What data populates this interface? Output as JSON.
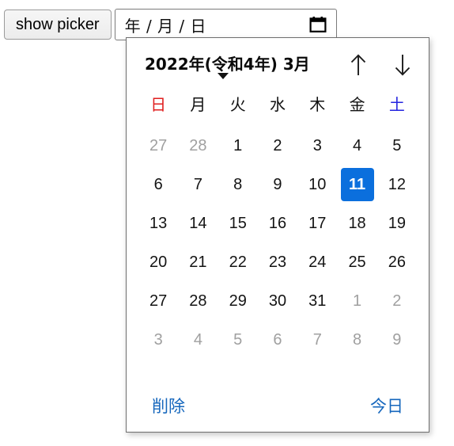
{
  "toolbar": {
    "show_picker_label": "show picker"
  },
  "date_input": {
    "placeholder_text": "年 / 月 / 日",
    "value": "",
    "calendar_icon": "calendar-icon"
  },
  "picker": {
    "header": {
      "month_title": "2022年(令和4年) 3月",
      "caret_icon": "chevron-down-icon",
      "prev_icon": "arrow-up-icon",
      "next_icon": "arrow-down-icon"
    },
    "weekdays": [
      {
        "label": "日",
        "kind": "sun"
      },
      {
        "label": "月",
        "kind": "weekday"
      },
      {
        "label": "火",
        "kind": "weekday"
      },
      {
        "label": "水",
        "kind": "weekday"
      },
      {
        "label": "木",
        "kind": "weekday"
      },
      {
        "label": "金",
        "kind": "weekday"
      },
      {
        "label": "土",
        "kind": "sat"
      }
    ],
    "weeks": [
      [
        {
          "label": "27",
          "state": "muted"
        },
        {
          "label": "28",
          "state": "muted"
        },
        {
          "label": "1",
          "state": "normal"
        },
        {
          "label": "2",
          "state": "normal"
        },
        {
          "label": "3",
          "state": "normal"
        },
        {
          "label": "4",
          "state": "normal"
        },
        {
          "label": "5",
          "state": "normal"
        }
      ],
      [
        {
          "label": "6",
          "state": "normal"
        },
        {
          "label": "7",
          "state": "normal"
        },
        {
          "label": "8",
          "state": "normal"
        },
        {
          "label": "9",
          "state": "normal"
        },
        {
          "label": "10",
          "state": "normal"
        },
        {
          "label": "11",
          "state": "selected"
        },
        {
          "label": "12",
          "state": "normal"
        }
      ],
      [
        {
          "label": "13",
          "state": "normal"
        },
        {
          "label": "14",
          "state": "normal"
        },
        {
          "label": "15",
          "state": "normal"
        },
        {
          "label": "16",
          "state": "normal"
        },
        {
          "label": "17",
          "state": "normal"
        },
        {
          "label": "18",
          "state": "normal"
        },
        {
          "label": "19",
          "state": "normal"
        }
      ],
      [
        {
          "label": "20",
          "state": "normal"
        },
        {
          "label": "21",
          "state": "normal"
        },
        {
          "label": "22",
          "state": "normal"
        },
        {
          "label": "23",
          "state": "normal"
        },
        {
          "label": "24",
          "state": "normal"
        },
        {
          "label": "25",
          "state": "normal"
        },
        {
          "label": "26",
          "state": "normal"
        }
      ],
      [
        {
          "label": "27",
          "state": "normal"
        },
        {
          "label": "28",
          "state": "normal"
        },
        {
          "label": "29",
          "state": "normal"
        },
        {
          "label": "30",
          "state": "normal"
        },
        {
          "label": "31",
          "state": "normal"
        },
        {
          "label": "1",
          "state": "muted"
        },
        {
          "label": "2",
          "state": "muted"
        }
      ],
      [
        {
          "label": "3",
          "state": "muted"
        },
        {
          "label": "4",
          "state": "muted"
        },
        {
          "label": "5",
          "state": "muted"
        },
        {
          "label": "6",
          "state": "muted"
        },
        {
          "label": "7",
          "state": "muted"
        },
        {
          "label": "8",
          "state": "muted"
        },
        {
          "label": "9",
          "state": "muted"
        }
      ]
    ],
    "footer": {
      "clear_label": "削除",
      "today_label": "今日"
    }
  },
  "colors": {
    "selected_bg": "#0b6fdd",
    "sunday": "#e01f1f",
    "saturday": "#2424e0",
    "link": "#1667bd",
    "muted": "#a0a0a0"
  }
}
